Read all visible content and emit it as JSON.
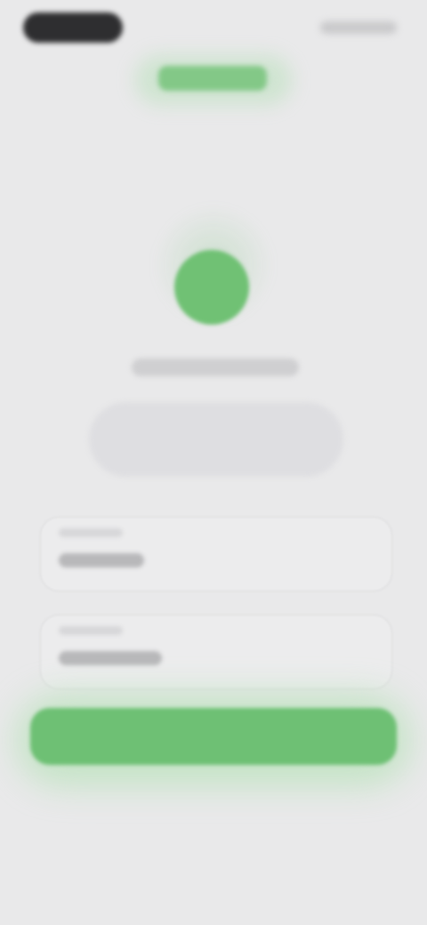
{
  "theme": {
    "background": "#e9e9ea",
    "accent": "#6ec074",
    "status_pill": "#2e2e30"
  },
  "status_bar": {
    "icons": [
      "status-pill-icon",
      "status-indicators-icon"
    ]
  },
  "header": {
    "title": ""
  },
  "profile": {
    "avatar_icon": "avatar-circle-icon",
    "name": "",
    "description": ""
  },
  "form": {
    "fields": [
      {
        "label": "",
        "value": ""
      },
      {
        "label": "",
        "value": ""
      }
    ]
  },
  "actions": {
    "primary_label": ""
  }
}
